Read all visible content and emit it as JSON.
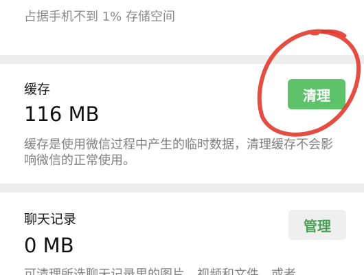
{
  "storage_note": "占据手机不到 1% 存储空间",
  "cache": {
    "title": "缓存",
    "size": "116 MB",
    "button": "清理",
    "description": "缓存是使用微信过程中产生的临时数据，清理缓存不会影响微信的正常使用。"
  },
  "chat_history": {
    "title": "聊天记录",
    "size": "0 MB",
    "button": "管理",
    "description": "可清理所选聊天记录里的图片、视频和文件，或者"
  },
  "colors": {
    "primary_button": "#5dc26a",
    "secondary_button_text": "#4aa054",
    "annotation_circle": "#e2392e"
  }
}
